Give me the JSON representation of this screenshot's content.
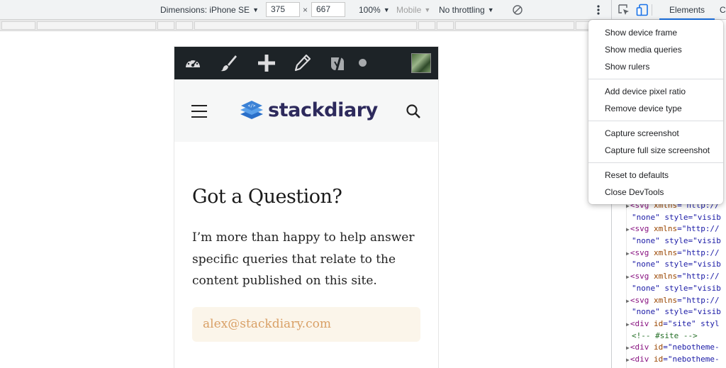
{
  "toolbar": {
    "dimensions_label": "Dimensions: iPhone SE",
    "width_value": "375",
    "times_sign": "×",
    "height_value": "667",
    "zoom_label": "100%",
    "device_type_label": "Mobile",
    "throttling_label": "No throttling",
    "rotate_icon": "rotate-icon",
    "more_icon": "more-vert-icon"
  },
  "devtools": {
    "tabs": [
      "Elements",
      "Co"
    ],
    "code_lines": [
      {
        "pre": "<svg ",
        "attr": "xmlns",
        "val": "=\"http://"
      },
      {
        "pre": "",
        "attr": "",
        "val": "\"none\" style=\"visib"
      },
      {
        "pre": "<svg ",
        "attr": "xmlns",
        "val": "=\"http://"
      },
      {
        "pre": "",
        "attr": "",
        "val": "\"none\" style=\"visib"
      },
      {
        "pre": "<svg ",
        "attr": "xmlns",
        "val": "=\"http://"
      },
      {
        "pre": "",
        "attr": "",
        "val": "\"none\" style=\"visib"
      },
      {
        "pre": "<svg ",
        "attr": "xmlns",
        "val": "=\"http://"
      },
      {
        "pre": "",
        "attr": "",
        "val": "\"none\" style=\"visib"
      },
      {
        "pre": "<svg ",
        "attr": "xmlns",
        "val": "=\"http://"
      },
      {
        "pre": "",
        "attr": "",
        "val": "\"none\" style=\"visib"
      },
      {
        "pre": "<div ",
        "attr": "id",
        "val": "=\"site\" styl"
      },
      {
        "pre": "",
        "attr": "",
        "val": "<!-- #site -->"
      },
      {
        "pre": "<div ",
        "attr": "id",
        "val": "=\"nebotheme-"
      },
      {
        "pre": "<div ",
        "attr": "id",
        "val": "=\"nebotheme-"
      }
    ]
  },
  "menu": {
    "groups": [
      [
        "Show device frame",
        "Show media queries",
        "Show rulers"
      ],
      [
        "Add device pixel ratio",
        "Remove device type"
      ],
      [
        "Capture screenshot",
        "Capture full size screenshot"
      ],
      [
        "Reset to defaults",
        "Close DevTools"
      ]
    ]
  },
  "page": {
    "admin_icons": [
      "dashboard-icon",
      "customize-brush-icon",
      "new-plus-icon",
      "edit-pencil-icon",
      "yoast-icon",
      "status-dot",
      "avatar"
    ],
    "logo_text": "stackdiary",
    "heading": "Got a Question?",
    "body": "I’m more than happy to help answer specific queries that relate to the content published on this site.",
    "email": "alex@stackdiary.com"
  },
  "colors": {
    "admin_bar": "#1d2327",
    "header_bg": "#f6f7f7",
    "logo_blue": "#3b82d6",
    "logo_navy": "#2d2a5c",
    "email_bg": "#fbf5ea",
    "email_text": "#d9a066",
    "accent": "#1a73e8"
  }
}
